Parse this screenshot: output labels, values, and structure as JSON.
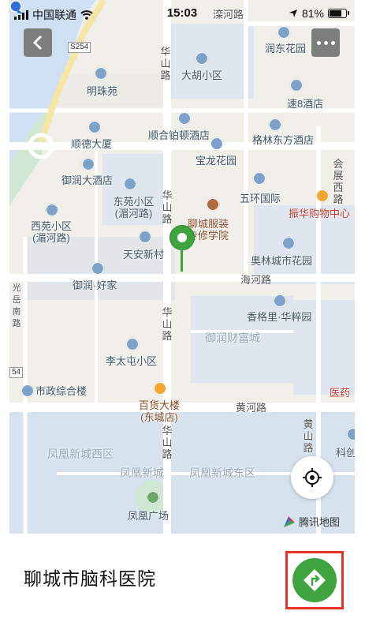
{
  "status_bar": {
    "carrier": "中国联通",
    "time": "15:03",
    "battery_text": "81%",
    "battery_level": 0.81
  },
  "map": {
    "streets": [
      "滦河路",
      "华山路",
      "华山路",
      "华山路",
      "华山路",
      "海河路",
      "黄河路",
      "会展西路",
      "黄山路",
      "光岳南路"
    ],
    "places": [
      "润东花园",
      "大胡小区",
      "明珠苑",
      "速8酒店",
      "顺合铂顿酒店",
      "顺德大厦",
      "格林东方酒店",
      "宝龙花园",
      "御润大酒店",
      "东苑小区(湄河路)",
      "五环国际",
      "振华购物中心",
      "西苑小区(湄河路)",
      "聊城服装专修学院",
      "天安新村",
      "奥林城市花园",
      "御润·好家",
      "香格里·华粹园",
      "御润财富城",
      "李太屯小区",
      "市政综合楼",
      "百货大楼(东城店)",
      "医药",
      "凤凰新城西区",
      "凤凰新城",
      "凤凰新城东区",
      "科创",
      "凤凰广场",
      "S254",
      "54"
    ],
    "attribution": "腾讯地图"
  },
  "controls": {
    "back_icon": "chevron-left-icon",
    "more_icon": "more-dots-icon",
    "locate_icon": "crosshair-icon",
    "navigate_icon": "navigation-arrow-icon"
  },
  "place": {
    "name": "聊城市脑科医院"
  },
  "colors": {
    "pin_green": "#3fa33f",
    "highlight_red": "#e63229",
    "water_blue": "#cfe0f2",
    "user_dot_blue": "#2f6fd6"
  }
}
